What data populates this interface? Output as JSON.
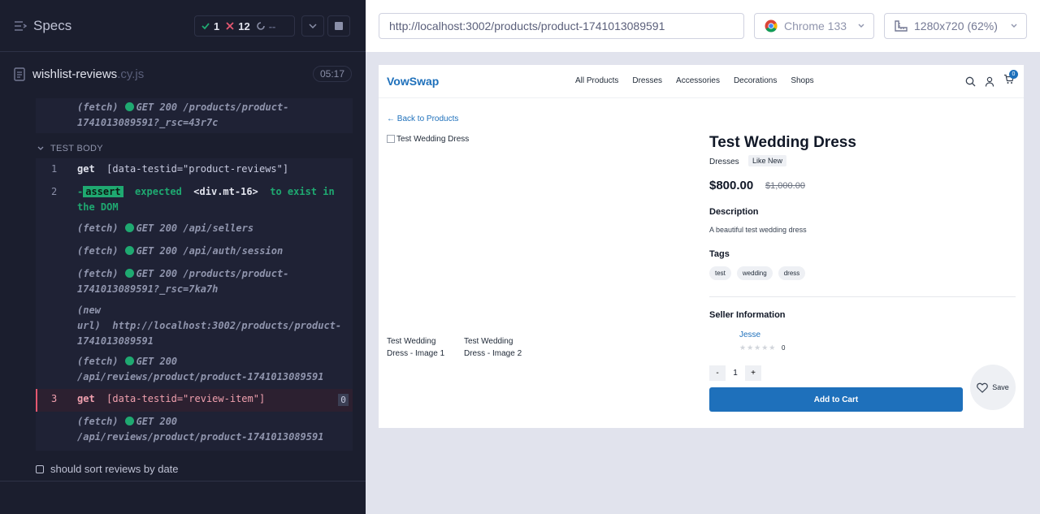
{
  "reporter": {
    "title": "Specs",
    "stats": {
      "passed": "1",
      "failed": "12",
      "pending": "--"
    },
    "file": {
      "name": "wishlist-reviews",
      "ext": ".cy.js"
    },
    "timer": "05:17",
    "test_body_label": "TEST BODY",
    "commands": [
      {
        "prefix": "(fetch)",
        "text1": "GET 200 /products/product-",
        "text2": "1741013089591?_rsc=43r7c"
      },
      {
        "num": "1",
        "name": "get",
        "selector": "[data-testid=\"product-reviews\"]"
      },
      {
        "num": "2",
        "prefix": "-",
        "badge": "assert",
        "text1": "expected",
        "code": "<div.mt-16>",
        "text2": "to exist in",
        "text3": "the DOM"
      },
      {
        "prefix": "(fetch)",
        "text1": "GET 200 /api/sellers"
      },
      {
        "prefix": "(fetch)",
        "text1": "GET 200 /api/auth/session"
      },
      {
        "prefix": "(fetch)",
        "text1": "GET 200 /products/product-",
        "text2": "1741013089591?_rsc=7ka7h"
      },
      {
        "prefix1": "(new",
        "prefix2": "url)",
        "text1": "http://localhost:3002/products/product-",
        "text2": "1741013089591"
      },
      {
        "prefix": "(fetch)",
        "text1": "GET 200",
        "text2": "/api/reviews/product/product-1741013089591"
      },
      {
        "num": "3",
        "name": "get",
        "selector": "[data-testid=\"review-item\"]",
        "count": "0"
      },
      {
        "prefix": "(fetch)",
        "text1": "GET 200",
        "text2": "/api/reviews/product/product-1741013089591"
      }
    ],
    "next_test": "should sort reviews by date"
  },
  "aut": {
    "url": "http://localhost:3002/products/product-1741013089591",
    "browser": "Chrome 133",
    "viewport": "1280x720",
    "scale": "(62%)"
  },
  "app": {
    "logo": "VowSwap",
    "nav": [
      "All Products",
      "Dresses",
      "Accessories",
      "Decorations",
      "Shops"
    ],
    "cart_count": "0",
    "back_link": "← Back to Products",
    "main_image_alt": "Test Wedding Dress",
    "thumb1_alt": "Test Wedding Dress - Image 1",
    "thumb2_alt": "Test Wedding Dress - Image 2",
    "product": {
      "title": "Test Wedding Dress",
      "category": "Dresses",
      "condition": "Like New",
      "price": "$800.00",
      "original_price": "$1,000.00",
      "description_heading": "Description",
      "description": "A beautiful test wedding dress",
      "tags_heading": "Tags",
      "tags": [
        "test",
        "wedding",
        "dress"
      ],
      "seller_heading": "Seller Information",
      "seller_name": "Jesse",
      "seller_rating_count": "0",
      "quantity": "1",
      "qty_minus": "-",
      "qty_plus": "+",
      "add_to_cart": "Add to Cart",
      "save": "Save"
    }
  },
  "colors": {
    "reporter_bg": "#1b1e2e",
    "pass_green": "#1fa971",
    "fail_red": "#e45770",
    "brand_blue": "#1e70bb"
  }
}
